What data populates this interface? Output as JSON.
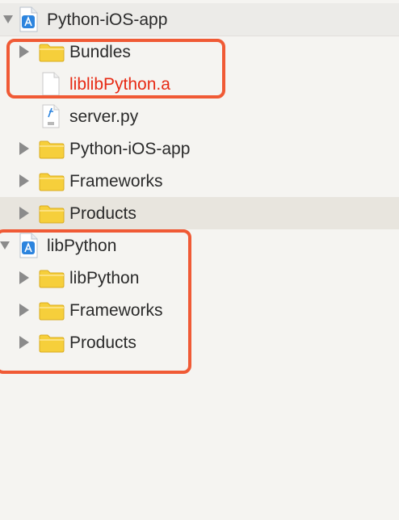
{
  "navigator": {
    "items": [
      {
        "label": "Python-iOS-app",
        "type": "project",
        "state": "expanded"
      },
      {
        "label": "Bundles",
        "type": "folder",
        "state": "collapsed"
      },
      {
        "label": "liblibPython.a",
        "type": "file",
        "label_color": "#e72a14"
      },
      {
        "label": "server.py",
        "type": "python-file"
      },
      {
        "label": "Python-iOS-app",
        "type": "folder",
        "state": "collapsed"
      },
      {
        "label": "Frameworks",
        "type": "folder",
        "state": "collapsed"
      },
      {
        "label": "Products",
        "type": "folder",
        "state": "collapsed",
        "selected": true
      },
      {
        "label": "libPython",
        "type": "project",
        "state": "expanded"
      },
      {
        "label": "libPython",
        "type": "folder",
        "state": "collapsed"
      },
      {
        "label": "Frameworks",
        "type": "folder",
        "state": "collapsed"
      },
      {
        "label": "Products",
        "type": "folder",
        "state": "collapsed"
      }
    ]
  },
  "colors": {
    "highlight_border": "#f05a35",
    "folder_fill": "#f6cf3b",
    "project_blue": "#2c84de",
    "missing_file_text": "#e72a14"
  }
}
